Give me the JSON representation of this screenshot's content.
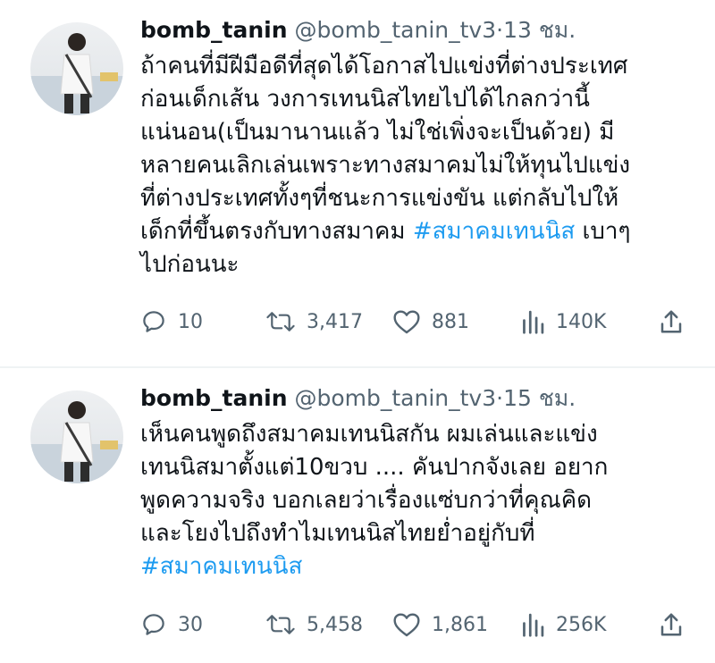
{
  "tweets": [
    {
      "display_name": "bomb_tanin",
      "handle": "@bomb_tanin_tv3",
      "separator": "·",
      "time": "13 ชม.",
      "text_lines": [
        "ถ้าคนที่มีฝีมือดีที่สุดได้โอกาสไปแข่งที่ต่างประเทศ",
        "ก่อนเด็กเส้น วงการเทนนิสไทยไปได้ไกลกว่านี้",
        "แน่นอน(เป็นมานานแล้ว ไม่ใช่เพิ่งจะเป็นด้วย) มี",
        "หลายคนเลิกเล่นเพราะทางสมาคมไม่ให้ทุนไปแข่ง",
        "ที่ต่างประเทศทั้งๆที่ชนะการแข่งขัน แต่กลับไปให้",
        "เด็กที่ขึ้นตรงกับทางสมาคม "
      ],
      "hashtag": "#สมาคมเทนนิส",
      "after_hashtag": " เบาๆ",
      "last_line": "ไปก่อนนะ",
      "replies": "10",
      "retweets": "3,417",
      "likes": "881",
      "views": "140K"
    },
    {
      "display_name": "bomb_tanin",
      "handle": "@bomb_tanin_tv3",
      "separator": "·",
      "time": "15 ชม.",
      "text_lines": [
        "เห็นคนพูดถึงสมาคมเทนนิสกัน ผมเล่นและแข่ง",
        "เทนนิสมาตั้งแต่10ขวบ .... คันปากจังเลย อยาก",
        "พูดความจริง บอกเลยว่าเรื่องแซ่บกว่าที่คุณคิด",
        "และโยงไปถึงทำไมเทนนิสไทยย่ำอยู่กับที่"
      ],
      "hashtag": "#สมาคมเทนนิส",
      "replies": "30",
      "retweets": "5,458",
      "likes": "1,861",
      "views": "256K"
    }
  ],
  "icons": {
    "reply": "reply-icon",
    "retweet": "retweet-icon",
    "like": "heart-icon",
    "views": "views-icon",
    "share": "share-icon"
  },
  "colors": {
    "text": "#0f1419",
    "secondary": "#536471",
    "link": "#1d9bf0",
    "divider": "#eff3f4"
  }
}
